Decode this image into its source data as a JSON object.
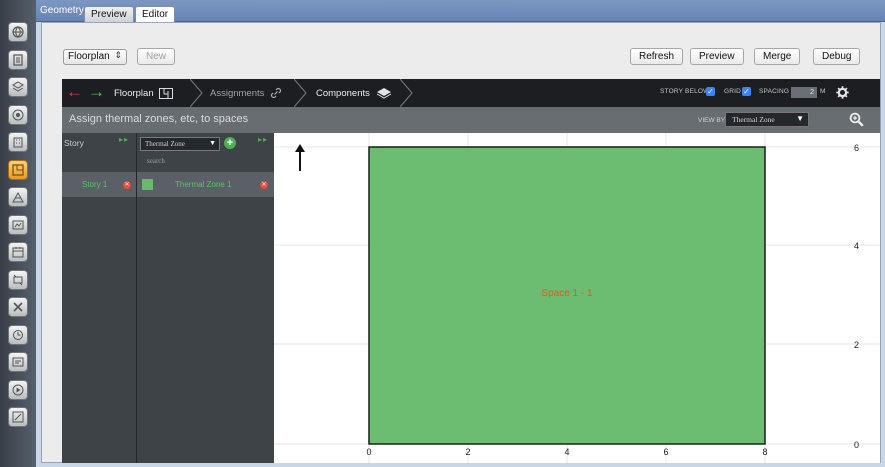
{
  "app": {
    "tab_label": "Geometry",
    "tabs": [
      {
        "label": "Preview",
        "active": false
      },
      {
        "label": "Editor",
        "active": true
      }
    ]
  },
  "left_toolbar": {
    "icons": [
      "globe-icon",
      "document-icon",
      "layers-icon",
      "target-icon",
      "building-icon",
      "floorplan-icon",
      "construction-icon",
      "loads-icon",
      "schedule-icon",
      "hvac-icon",
      "tools-icon",
      "measure-icon",
      "output-icon",
      "run-icon",
      "results-icon"
    ],
    "active_index": 5
  },
  "toolbar": {
    "floorplan_select": "Floorplan",
    "new_label": "New",
    "refresh_label": "Refresh",
    "preview_label": "Preview",
    "merge_label": "Merge",
    "debug_label": "Debug"
  },
  "nav": {
    "back_icon": "back-arrow-icon",
    "forward_icon": "forward-arrow-icon",
    "floorplan_label": "Floorplan",
    "assignments_label": "Assignments",
    "components_label": "Components",
    "story_below_label": "STORY BELOW",
    "grid_label": "GRID",
    "spacing_label": "SPACING",
    "spacing_value": "2",
    "spacing_unit": "M",
    "story_below_checked": true,
    "grid_checked": true
  },
  "instruction": {
    "text": "Assign thermal zones, etc, to spaces",
    "view_by_label": "VIEW BY",
    "view_by_value": "Thermal Zone"
  },
  "story_pane": {
    "title": "Story",
    "items": [
      {
        "label": "Story 1"
      }
    ]
  },
  "zone_pane": {
    "type_select": "Thermal Zone",
    "search_placeholder": "search",
    "items": [
      {
        "label": "Thermal Zone 1",
        "color": "#67b96c"
      }
    ]
  },
  "canvas": {
    "space_label": "Space 1 - 1",
    "space_fill": "#6cbc72",
    "space_label_color": "#e25b1f",
    "x_ticks": [
      "0",
      "2",
      "4",
      "6",
      "8"
    ],
    "y_ticks": [
      "0",
      "2",
      "4",
      "6"
    ],
    "space_extent_x": [
      0,
      8
    ],
    "space_extent_y": [
      0,
      6
    ]
  }
}
